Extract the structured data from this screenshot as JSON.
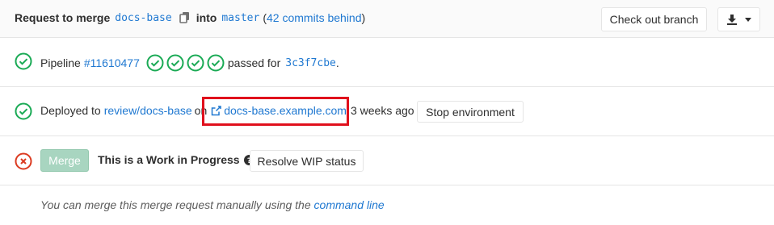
{
  "header": {
    "request_label": "Request to merge",
    "source_branch": "docs-base",
    "into_label": "into",
    "target_branch": "master",
    "paren_open": "(",
    "commits_behind": "42 commits behind",
    "paren_close": ")",
    "checkout_label": "Check out branch",
    "download_icon": "download-icon",
    "dropdown_icon": "caret-down-icon"
  },
  "pipeline": {
    "label": "Pipeline",
    "id": "#11610477",
    "stages": [
      "passed",
      "passed",
      "passed",
      "passed"
    ],
    "status_text": "passed for",
    "commit": "3c3f7cbe",
    "period": ".",
    "status_color": "#1aaa55"
  },
  "deployment": {
    "label": "Deployed to",
    "environment": "review/docs-base",
    "on_label": "on",
    "url": "docs-base.example.com",
    "time": "3 weeks ago",
    "stop_label": "Stop environment",
    "external_icon": "external-link-icon"
  },
  "merge": {
    "button_label": "Merge",
    "wip_text": "This is a Work in Progress",
    "resolve_label": "Resolve WIP status",
    "status_color": "#db3b21",
    "help_icon": "question-circle-icon"
  },
  "manual": {
    "text": "You can merge this merge request manually using the",
    "link": "command line"
  },
  "colors": {
    "link": "#1f78d1",
    "success": "#1aaa55",
    "failed": "#db3b21",
    "highlight": "#e0101c"
  }
}
